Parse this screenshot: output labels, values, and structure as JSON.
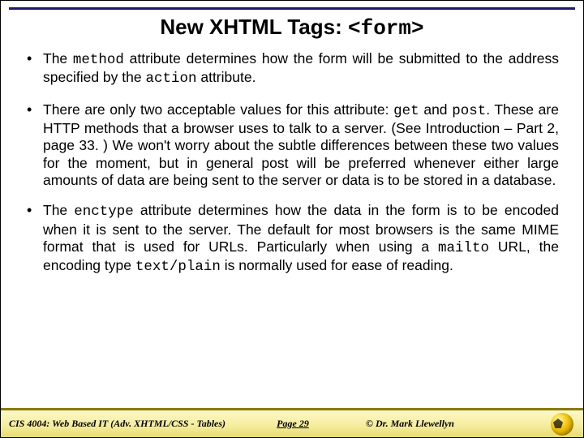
{
  "title": {
    "prefix": "New XHTML Tags: ",
    "tag": "<form>"
  },
  "bullets": [
    {
      "parts": [
        {
          "t": "The "
        },
        {
          "t": "method",
          "c": true
        },
        {
          "t": " attribute determines how the form will be submitted to the address specified by the "
        },
        {
          "t": "action",
          "c": true
        },
        {
          "t": " attribute."
        }
      ]
    },
    {
      "parts": [
        {
          "t": "There are only two acceptable values for this attribute: "
        },
        {
          "t": "get",
          "c": true
        },
        {
          "t": " and "
        },
        {
          "t": "post",
          "c": true
        },
        {
          "t": ".  These are HTTP methods that a browser uses to talk to a server.  (See Introduction – Part 2, page 33. )  We won't worry about the subtle differences between these two values for the moment, but in general post will be preferred whenever either large amounts of data are being sent to the server or data is to be stored in a database."
        }
      ]
    },
    {
      "parts": [
        {
          "t": "The "
        },
        {
          "t": "enctype",
          "c": true
        },
        {
          "t": " attribute determines how the data in the form is to be encoded when it is sent to the server.  The default for most browsers is the same MIME format that is used for URLs.  Particularly when using a "
        },
        {
          "t": "mailto",
          "c": true
        },
        {
          "t": " URL, the encoding type "
        },
        {
          "t": "text/plain",
          "c": true
        },
        {
          "t": " is normally used for ease of reading."
        }
      ]
    }
  ],
  "footer": {
    "course": "CIS 4004: Web Based IT (Adv. XHTML/CSS - Tables)",
    "page": "Page 29",
    "author": "© Dr. Mark Llewellyn"
  }
}
